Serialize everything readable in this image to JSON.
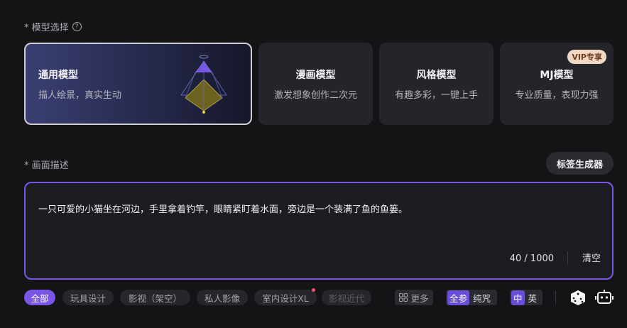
{
  "model_section": {
    "label": "* 模型选择",
    "help_icon": "question-circle-icon"
  },
  "models": [
    {
      "title": "通用模型",
      "subtitle": "描人绘景，真实生动",
      "active": true
    },
    {
      "title": "漫画模型",
      "subtitle": "激发想象创作二次元"
    },
    {
      "title": "风格模型",
      "subtitle": "有趣多彩，一键上手"
    },
    {
      "title": "MJ模型",
      "subtitle": "专业质量，表现力强",
      "badge": "VIP专享"
    }
  ],
  "desc_section": {
    "label": "* 画面描述",
    "generator_button": "标签生成器"
  },
  "prompt": {
    "text": "一只可爱的小猫坐在河边，手里拿着钓竿，眼睛紧盯着水面，旁边是一个装满了鱼的鱼篓。",
    "counter": "40 / 1000",
    "clear": "清空"
  },
  "tags": [
    "全部",
    "玩具设计",
    "影视（架空）",
    "私人影像",
    "室内设计XL",
    "影视近代"
  ],
  "more_label": "更多",
  "mode_toggle": {
    "on": "全参",
    "off": "纯咒"
  },
  "lang_toggle": {
    "on": "中",
    "off": "英"
  },
  "icons": {
    "dice": "dice-icon",
    "robot": "robot-icon",
    "grid": "grid-icon"
  },
  "colors": {
    "accent": "#7a56e6",
    "background": "#141416",
    "card": "#24252b",
    "badge": "#f3d9c4",
    "dot": "#ff4d6d"
  }
}
